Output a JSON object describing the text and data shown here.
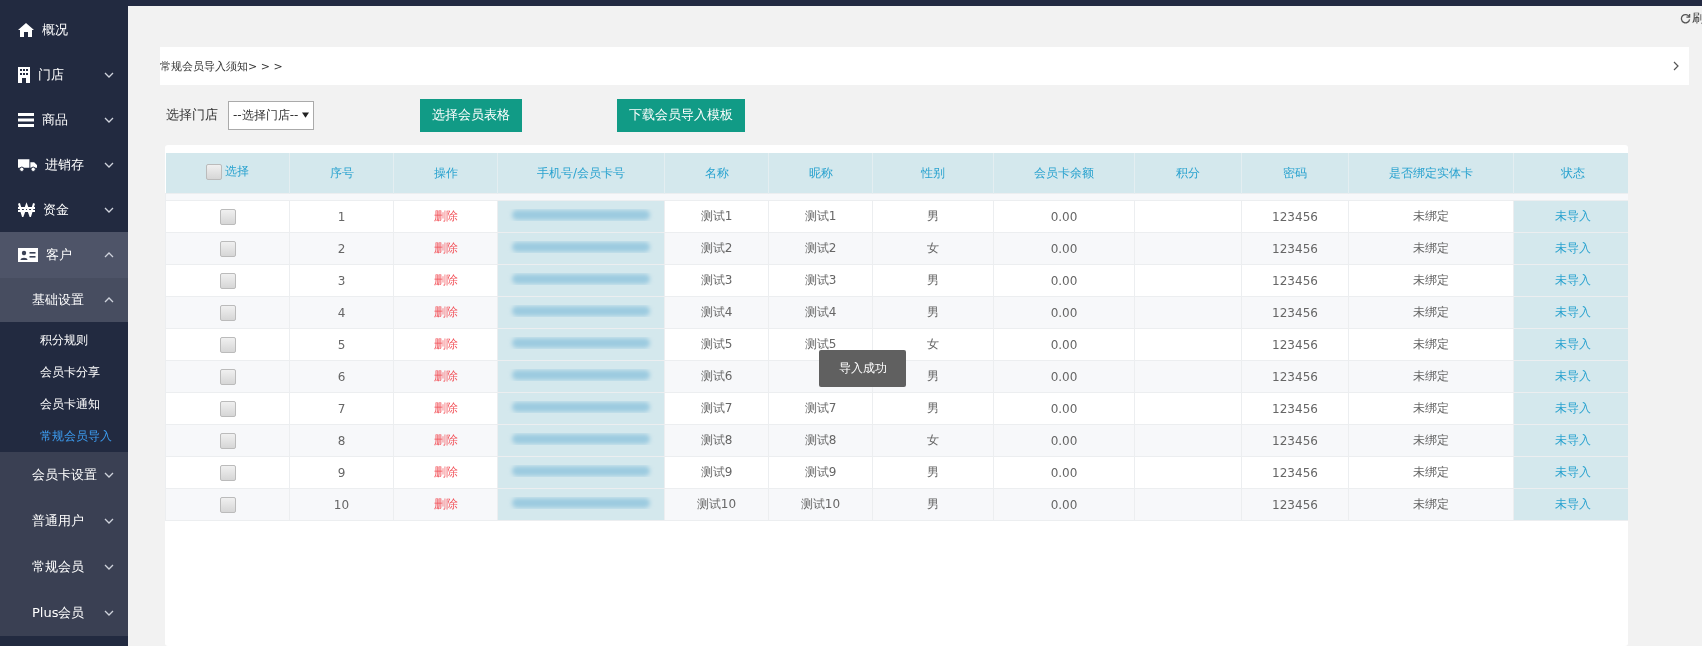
{
  "sidebar": {
    "items": [
      {
        "label": "概况"
      },
      {
        "label": "门店",
        "expanded": false
      },
      {
        "label": "商品",
        "expanded": false
      },
      {
        "label": "进销存",
        "expanded": false
      },
      {
        "label": "资金",
        "expanded": false
      },
      {
        "label": "客户",
        "expanded": true,
        "children": [
          {
            "label": "基础设置",
            "expanded": true,
            "children": [
              {
                "label": "积分规则",
                "selected": false
              },
              {
                "label": "会员卡分享",
                "selected": false
              },
              {
                "label": "会员卡通知",
                "selected": false
              },
              {
                "label": "常规会员导入",
                "selected": true
              }
            ]
          },
          {
            "label": "会员卡设置",
            "expanded": false
          },
          {
            "label": "普通用户",
            "expanded": false
          },
          {
            "label": "常规会员",
            "expanded": false
          },
          {
            "label": "Plus会员",
            "expanded": false
          }
        ]
      }
    ]
  },
  "refresh": {
    "label": "刷"
  },
  "notice": {
    "text": "常规会员导入须知> > >"
  },
  "toolbar": {
    "store_label": "选择门店",
    "store_select": "--选择门店--",
    "buttons": [
      "选择会员表格",
      "下载会员导入模板"
    ]
  },
  "table": {
    "select_all": {
      "label": "选择",
      "checked": false
    },
    "columns": [
      "序号",
      "操作",
      "手机号/会员卡号",
      "名称",
      "昵称",
      "性别",
      "会员卡余额",
      "积分",
      "密码",
      "是否绑定实体卡",
      "状态"
    ],
    "rows": [
      {
        "checked": false,
        "no": "1",
        "action": "删除",
        "name": "测试1",
        "nickname": "测试1",
        "gender": "男",
        "balance": "0.00",
        "password": "123456",
        "bound": "未绑定",
        "status": "未导入"
      },
      {
        "checked": false,
        "no": "2",
        "action": "删除",
        "name": "测试2",
        "nickname": "测试2",
        "gender": "女",
        "balance": "0.00",
        "password": "123456",
        "bound": "未绑定",
        "status": "未导入"
      },
      {
        "checked": false,
        "no": "3",
        "action": "删除",
        "name": "测试3",
        "nickname": "测试3",
        "gender": "男",
        "balance": "0.00",
        "password": "123456",
        "bound": "未绑定",
        "status": "未导入"
      },
      {
        "checked": false,
        "no": "4",
        "action": "删除",
        "name": "测试4",
        "nickname": "测试4",
        "gender": "男",
        "balance": "0.00",
        "password": "123456",
        "bound": "未绑定",
        "status": "未导入"
      },
      {
        "checked": false,
        "no": "5",
        "action": "删除",
        "name": "测试5",
        "nickname": "测试5",
        "gender": "女",
        "balance": "0.00",
        "password": "123456",
        "bound": "未绑定",
        "status": "未导入"
      },
      {
        "checked": false,
        "no": "6",
        "action": "删除",
        "name": "测试6",
        "gender": "男",
        "balance": "0.00",
        "password": "123456",
        "bound": "未绑定",
        "status": "未导入"
      },
      {
        "checked": false,
        "no": "7",
        "action": "删除",
        "name": "测试7",
        "nickname": "测试7",
        "gender": "男",
        "balance": "0.00",
        "password": "123456",
        "bound": "未绑定",
        "status": "未导入"
      },
      {
        "checked": false,
        "no": "8",
        "action": "删除",
        "name": "测试8",
        "nickname": "测试8",
        "gender": "女",
        "balance": "0.00",
        "password": "123456",
        "bound": "未绑定",
        "status": "未导入"
      },
      {
        "checked": false,
        "no": "9",
        "action": "删除",
        "name": "测试9",
        "nickname": "测试9",
        "gender": "男",
        "balance": "0.00",
        "password": "123456",
        "bound": "未绑定",
        "status": "未导入"
      },
      {
        "checked": false,
        "no": "10",
        "action": "删除",
        "name": "测试10",
        "nickname": "测试10",
        "gender": "男",
        "balance": "0.00",
        "password": "123456",
        "bound": "未绑定",
        "status": "未导入"
      }
    ]
  },
  "toast": {
    "text": "导入成功"
  }
}
